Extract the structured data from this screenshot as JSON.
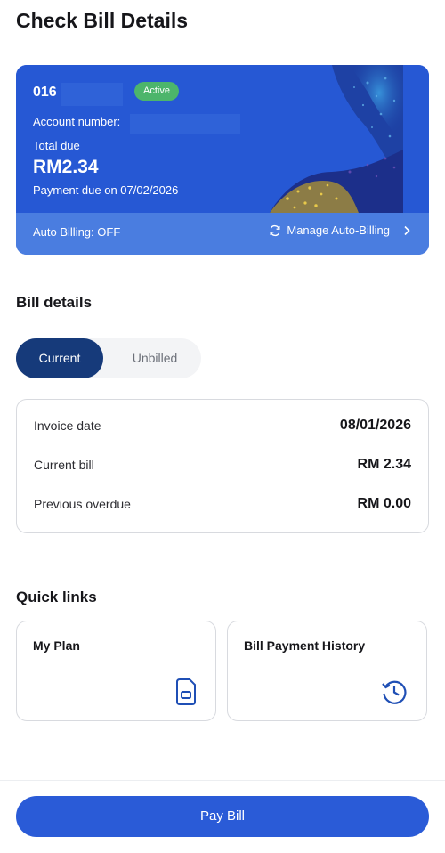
{
  "page": {
    "title": "Check Bill Details"
  },
  "account_card": {
    "number_prefix": "016",
    "status_badge": "Active",
    "account_number_label": "Account number:",
    "total_due_label": "Total due",
    "total_due_amount": "RM2.34",
    "payment_due": "Payment due on 07/02/2026",
    "auto_billing": "Auto Billing: OFF",
    "manage_auto_billing": "Manage Auto-Billing",
    "colors": {
      "card": "#2658d4",
      "footer": "#4a7de0",
      "badge": "#4cb56b"
    }
  },
  "bill_details": {
    "title": "Bill details",
    "tabs": [
      {
        "label": "Current",
        "selected": true
      },
      {
        "label": "Unbilled",
        "selected": false
      }
    ],
    "rows": [
      {
        "label": "Invoice date",
        "value": "08/01/2026"
      },
      {
        "label": "Current bill",
        "value": "RM 2.34"
      },
      {
        "label": "Previous overdue",
        "value": "RM 0.00"
      }
    ]
  },
  "quick_links": {
    "title": "Quick links",
    "items": [
      {
        "label": "My Plan",
        "icon": "sim-card-icon"
      },
      {
        "label": "Bill Payment History",
        "icon": "history-icon"
      }
    ]
  },
  "footer": {
    "pay_button": "Pay Bill"
  },
  "theme": {
    "primary": "#2a5bd7",
    "dark_tab": "#163a7a",
    "icon_blue": "#1f4fb5"
  }
}
